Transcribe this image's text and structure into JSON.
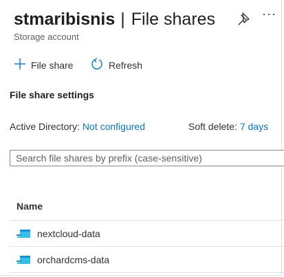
{
  "header": {
    "resource_name": "stmaribisnis",
    "separator": "|",
    "page_title": "File shares",
    "subtitle": "Storage account",
    "more_label": "···"
  },
  "commands": {
    "add_label": "File share",
    "refresh_label": "Refresh"
  },
  "settings": {
    "section_title": "File share settings",
    "active_directory_label": "Active Directory:",
    "active_directory_value": "Not configured",
    "soft_delete_label": "Soft delete:",
    "soft_delete_value": "7 days"
  },
  "search": {
    "placeholder": "Search file shares by prefix (case-sensitive)"
  },
  "table": {
    "columns": [
      "Name"
    ],
    "rows": [
      {
        "name": "nextcloud-data",
        "icon": "file-share-icon"
      },
      {
        "name": "orchardcms-data",
        "icon": "file-share-icon"
      }
    ]
  },
  "colors": {
    "accent": "#0078d4",
    "share_icon": "#32bfe8"
  }
}
